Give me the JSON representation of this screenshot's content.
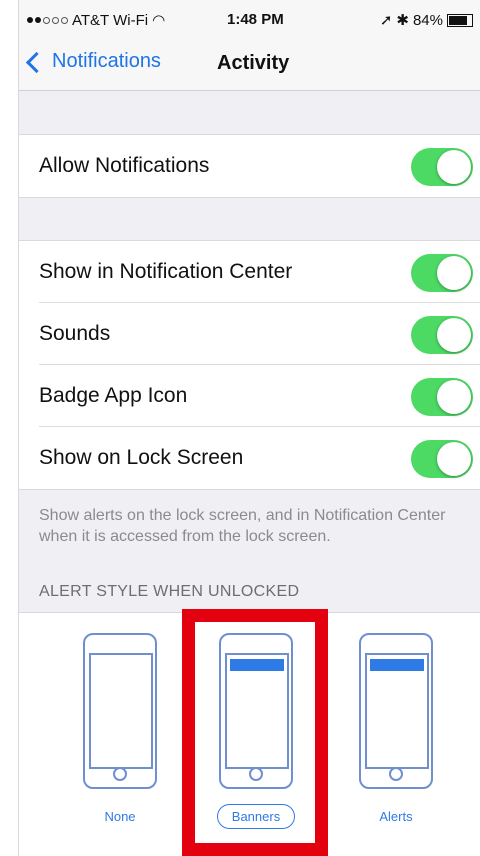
{
  "status_bar": {
    "carrier": "AT&T Wi-Fi",
    "time": "1:48 PM",
    "battery": "84%"
  },
  "nav": {
    "back_label": "Notifications",
    "title": "Activity"
  },
  "group1": {
    "items": [
      {
        "label": "Allow Notifications",
        "on": true
      }
    ]
  },
  "group2": {
    "items": [
      {
        "label": "Show in Notification Center",
        "on": true
      },
      {
        "label": "Sounds",
        "on": true
      },
      {
        "label": "Badge App Icon",
        "on": true
      },
      {
        "label": "Show on Lock Screen",
        "on": true
      }
    ]
  },
  "lock_screen_note": "Show alerts on the lock screen, and in Notification Center when it is accessed from the lock screen.",
  "alert_style": {
    "header": "ALERT STYLE WHEN UNLOCKED",
    "options": [
      {
        "label": "None",
        "selected": false
      },
      {
        "label": "Banners",
        "selected": true
      },
      {
        "label": "Alerts",
        "selected": false
      }
    ]
  },
  "colors": {
    "accent": "#1f74e6",
    "switch_on": "#4cd964",
    "highlight": "#e3000f"
  }
}
